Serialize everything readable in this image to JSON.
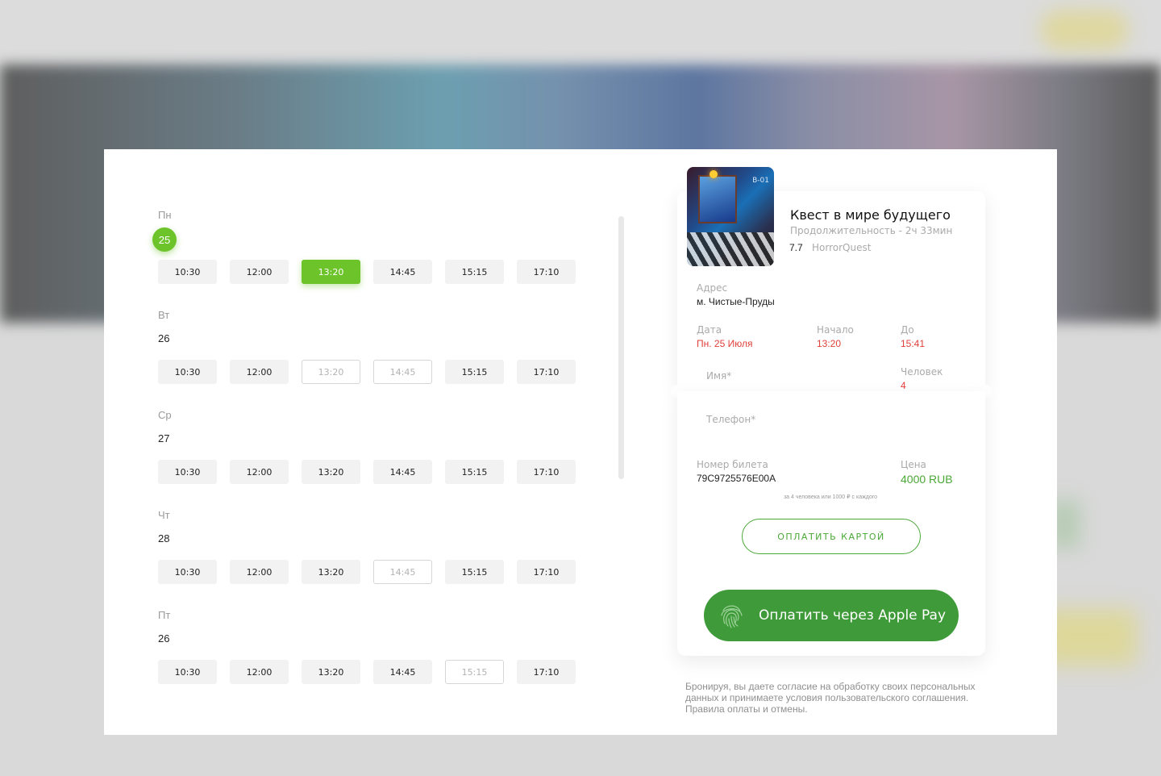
{
  "schedule": {
    "days": [
      {
        "name": "Пн",
        "num": "25",
        "active": true,
        "slots": [
          {
            "time": "10:30",
            "state": "normal"
          },
          {
            "time": "12:00",
            "state": "normal"
          },
          {
            "time": "13:20",
            "state": "selected"
          },
          {
            "time": "14:45",
            "state": "normal"
          },
          {
            "time": "15:15",
            "state": "normal"
          },
          {
            "time": "17:10",
            "state": "normal"
          }
        ]
      },
      {
        "name": "Вт",
        "num": "26",
        "active": false,
        "slots": [
          {
            "time": "10:30",
            "state": "normal"
          },
          {
            "time": "12:00",
            "state": "normal"
          },
          {
            "time": "13:20",
            "state": "disabled"
          },
          {
            "time": "14:45",
            "state": "disabled"
          },
          {
            "time": "15:15",
            "state": "normal"
          },
          {
            "time": "17:10",
            "state": "normal"
          }
        ]
      },
      {
        "name": "Ср",
        "num": "27",
        "active": false,
        "slots": [
          {
            "time": "10:30",
            "state": "normal"
          },
          {
            "time": "12:00",
            "state": "normal"
          },
          {
            "time": "13:20",
            "state": "normal"
          },
          {
            "time": "14:45",
            "state": "normal"
          },
          {
            "time": "15:15",
            "state": "normal"
          },
          {
            "time": "17:10",
            "state": "normal"
          }
        ]
      },
      {
        "name": "Чт",
        "num": "28",
        "active": false,
        "slots": [
          {
            "time": "10:30",
            "state": "normal"
          },
          {
            "time": "12:00",
            "state": "normal"
          },
          {
            "time": "13:20",
            "state": "normal"
          },
          {
            "time": "14:45",
            "state": "disabled"
          },
          {
            "time": "15:15",
            "state": "normal"
          },
          {
            "time": "17:10",
            "state": "normal"
          }
        ]
      },
      {
        "name": "Пт",
        "num": "26",
        "active": false,
        "slots": [
          {
            "time": "10:30",
            "state": "normal"
          },
          {
            "time": "12:00",
            "state": "normal"
          },
          {
            "time": "13:20",
            "state": "normal"
          },
          {
            "time": "14:45",
            "state": "normal"
          },
          {
            "time": "15:15",
            "state": "disabled"
          },
          {
            "time": "17:10",
            "state": "normal"
          }
        ]
      }
    ]
  },
  "quest": {
    "title": "Квест в мире будущего",
    "duration": "Продолжительность  -  2ч 33мин",
    "rating": "7.7",
    "brand": "HorrorQuest",
    "poster_tag": "B-01"
  },
  "ticket": {
    "address_label": "Адрес",
    "address_value": "м. Чистые-Пруды",
    "date_label": "Дата",
    "date_value": "Пн. 25 Июля",
    "start_label": "Начало",
    "start_value": "13:20",
    "end_label": "До",
    "end_value": "15:41",
    "name_label": "Имя*",
    "people_label": "Человек",
    "people_value": "4",
    "phone_label": "Телефон*",
    "ticket_label": "Номер билета",
    "ticket_value": "79C9725576E00A",
    "price_label": "Цена",
    "price_value": "4000 RUB",
    "price_note": "за 4 человека или 1000 ₽ с каждого",
    "pay_card": "ОПЛАТИТЬ КАРТОЙ",
    "apple_pay": "Оплатить через Apple Pay"
  },
  "consent": {
    "line1": "Бронируя, вы даете согласие на обработку своих персональных",
    "line2": "данных и принимаете условия пользовательского соглашения.",
    "line3": "Правила оплаты и отмены."
  },
  "colors": {
    "accent": "#6dc32a",
    "pay_green": "#3f9a3a",
    "red": "#e0403a"
  }
}
